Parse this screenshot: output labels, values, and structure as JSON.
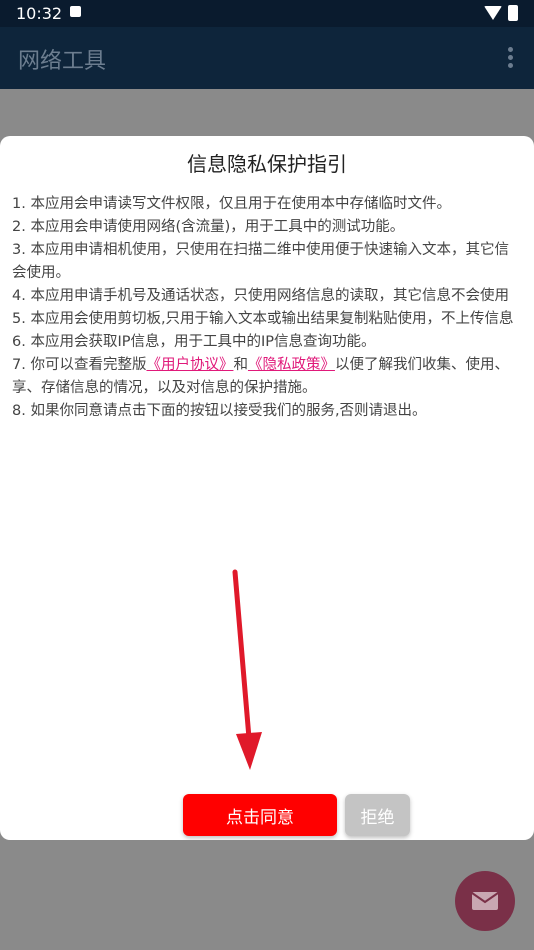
{
  "status_bar": {
    "time": "10:32"
  },
  "app_bar": {
    "title": "网络工具"
  },
  "dialog": {
    "title": "信息隐私保护指引",
    "lines": [
      "1. 本应用会申请读写文件权限，仅且用于在使用本中存储临时文件。",
      "2. 本应用会申请使用网络(含流量)，用于工具中的测试功能。",
      "3. 本应用申请相机使用，只使用在扫描二维中使用便于快速输入文本，其它信",
      "会使用。",
      "4. 本应用申请手机号及通话状态，只使用网络信息的读取，其它信息不会使用",
      "5. 本应用会使用剪切板,只用于输入文本或输出结果复制粘贴使用，不上传信息",
      "6. 本应用会获取IP信息，用于工具中的IP信息查询功能。"
    ],
    "line7_prefix": "7. 你可以查看完整版",
    "user_agreement_link": "《用户协议》",
    "and_text": "和",
    "privacy_policy_link": "《隐私政策》",
    "line7_suffix": "以便了解我们收集、使用、",
    "line7_continued": "享、存储信息的情况，以及对信息的保护措施。",
    "line8": "8. 如果你同意请点击下面的按钮以接受我们的服务,否则请退出。",
    "agree_label": "点击同意",
    "reject_label": "拒绝"
  },
  "fab": {
    "icon": "mail-icon"
  },
  "colors": {
    "agree": "#ff0000",
    "reject": "#c4c4c4",
    "link": "#e0197a",
    "app_bar": "#0e253b",
    "fab": "#7a3048",
    "arrow": "#e0192a"
  }
}
